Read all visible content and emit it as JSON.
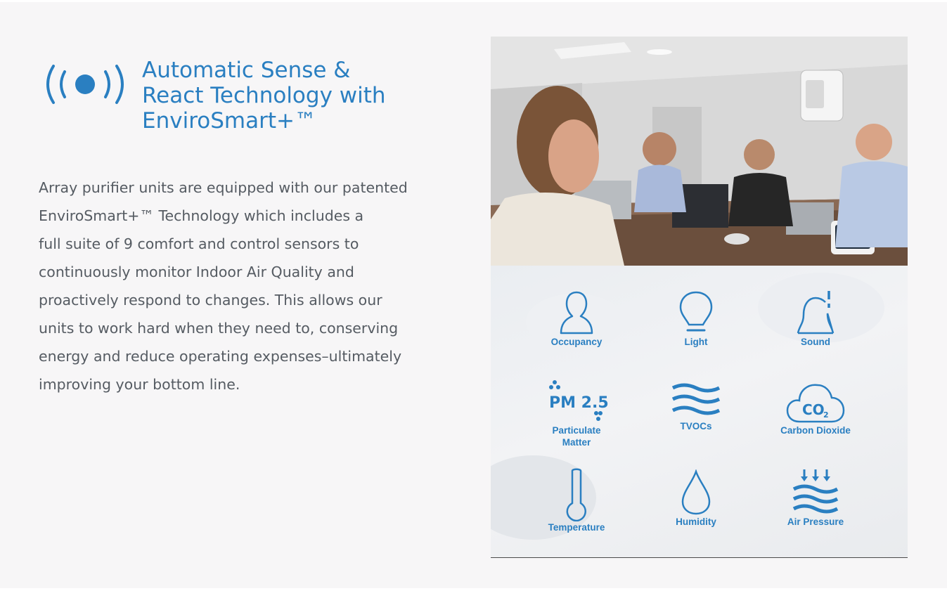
{
  "heading": {
    "lines": [
      "Automatic Sense &",
      "React Technology with",
      "EnviroSmart+™"
    ]
  },
  "body": {
    "lines": [
      "Array purifier units are equipped with our patented",
      "EnviroSmart+™ Technology which includes a",
      "full suite of 9 comfort and control sensors to",
      "continuously monitor Indoor Air Quality and",
      "proactively respond to changes. This allows our",
      "units to work hard when they need to, conserving",
      "energy and reduce operating expenses–ultimately",
      "improving your bottom line."
    ]
  },
  "sensors": [
    {
      "label": "Occupancy",
      "icon": "person-icon"
    },
    {
      "label": "Light",
      "icon": "lightbulb-icon"
    },
    {
      "label": "Sound",
      "icon": "bell-icon"
    },
    {
      "label": "Particulate Matter",
      "icon": "pm25-icon",
      "icon_text": "PM 2.5"
    },
    {
      "label": "TVOCs",
      "icon": "waves-icon"
    },
    {
      "label": "Carbon Dioxide",
      "icon": "cloud-co2-icon",
      "icon_text": "CO",
      "icon_sub": "2"
    },
    {
      "label": "Temperature",
      "icon": "thermometer-icon"
    },
    {
      "label": "Humidity",
      "icon": "droplet-icon"
    },
    {
      "label": "Air Pressure",
      "icon": "pressure-icon"
    }
  ],
  "colors": {
    "accent": "#2a7fc1",
    "body_text": "#555b62",
    "background": "#f7f6f7"
  }
}
